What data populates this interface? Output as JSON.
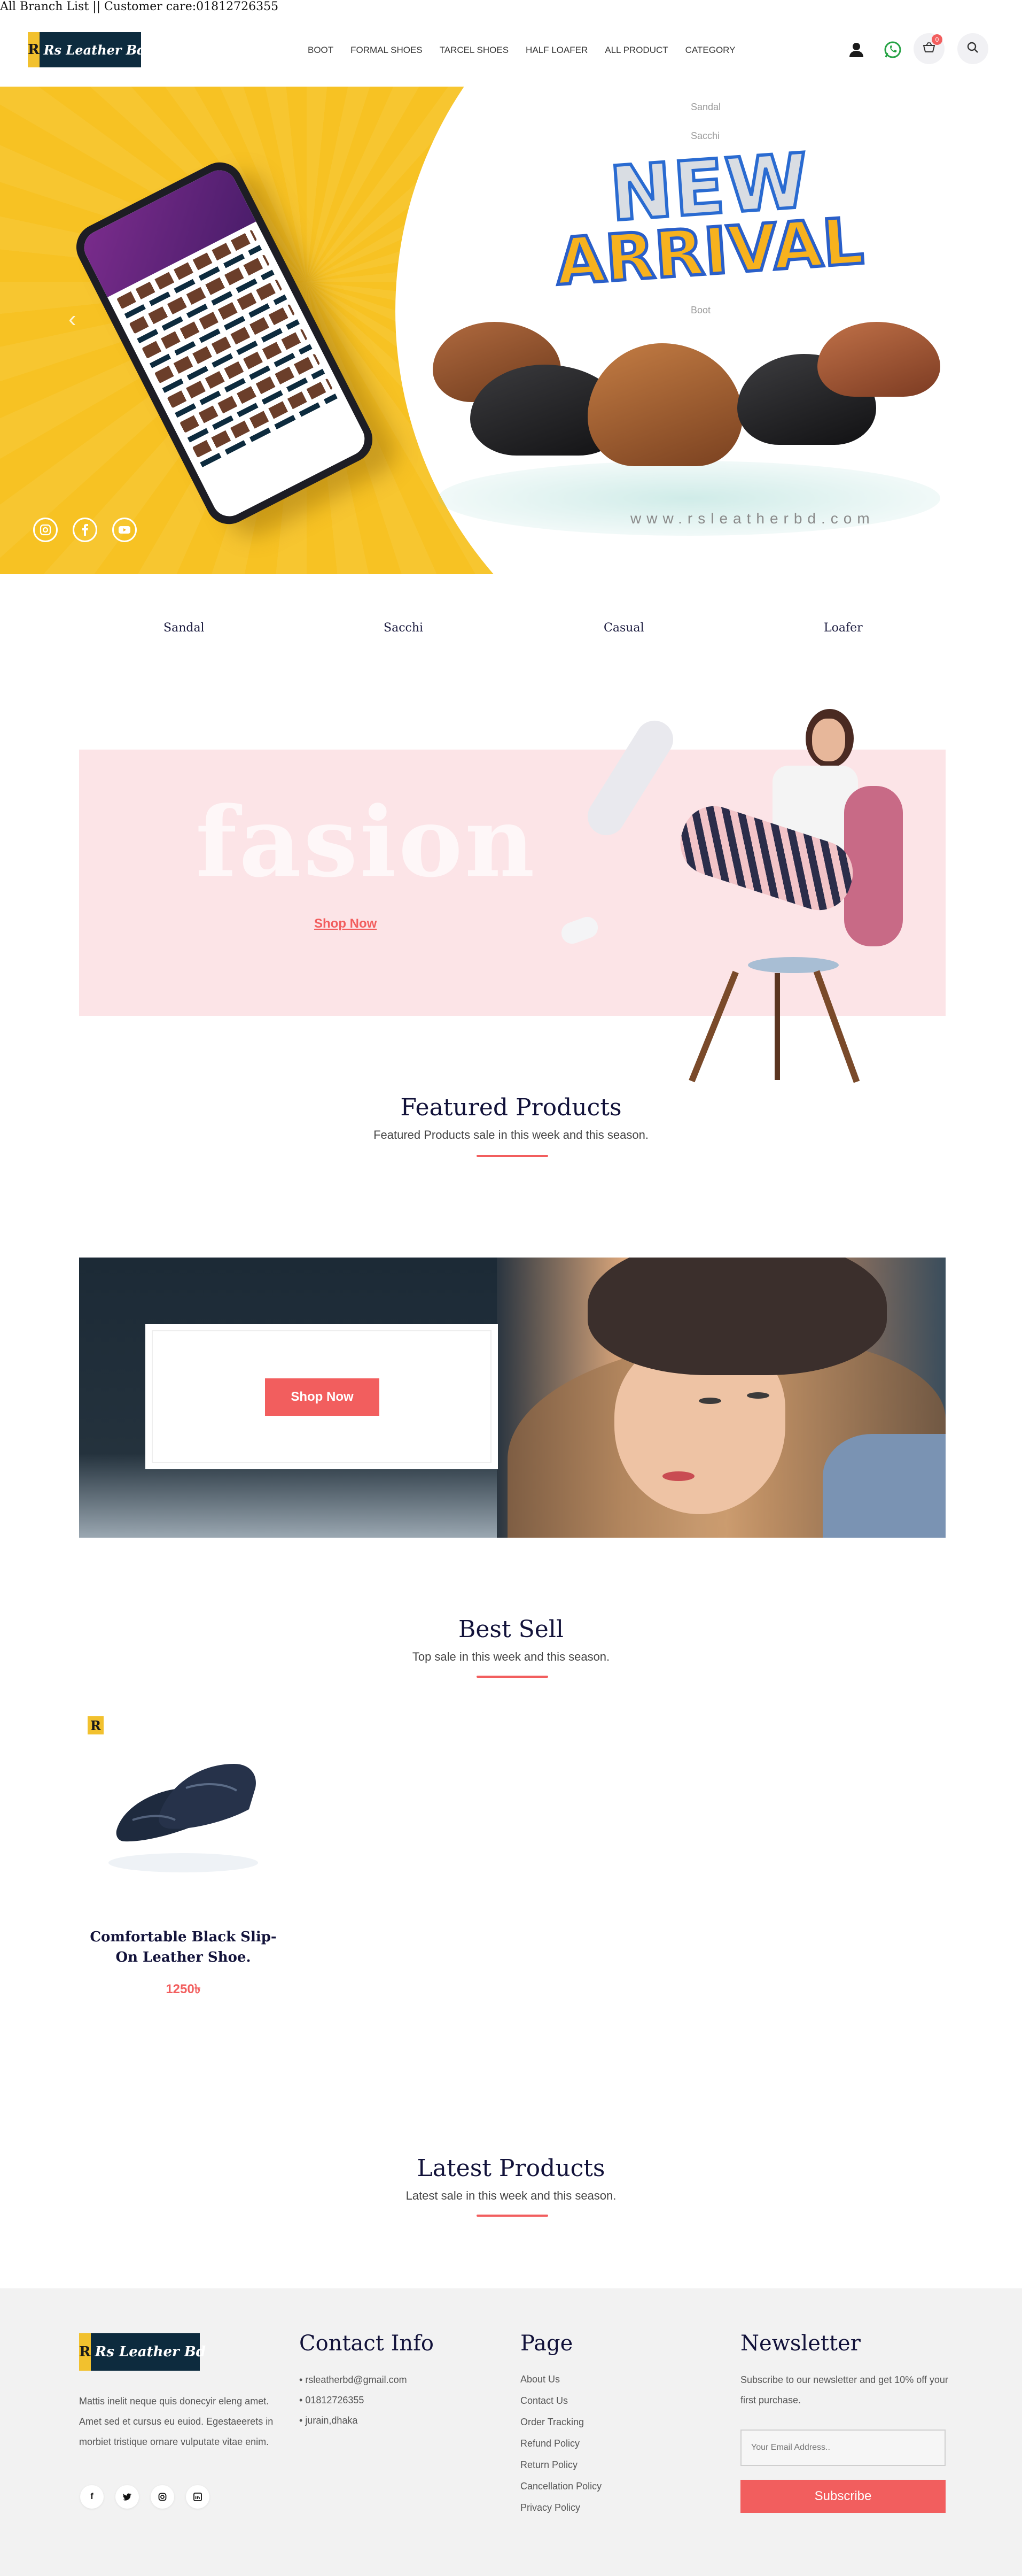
{
  "topbar": {
    "text": "All Branch List || Customer care:01812726355"
  },
  "header": {
    "logo_mark": "R",
    "logo_text": "Rs Leather Bd",
    "nav": [
      "BOOT",
      "FORMAL SHOES",
      "TARCEL SHOES",
      "HALF LOAFER",
      "ALL PRODUCT",
      "CATEGORY"
    ],
    "cart_count": "0",
    "icons": [
      "user-icon",
      "whatsapp-icon",
      "cart-icon",
      "search-icon"
    ]
  },
  "category_dropdown": [
    "Sandal",
    "Sacchi",
    "Boot"
  ],
  "hero": {
    "title_line1": "NEW",
    "title_line2": "ARRIVAL",
    "url": "www.rsleatherbd.com",
    "prev_arrow": "‹",
    "social": [
      "instagram-icon",
      "facebook-icon",
      "youtube-icon"
    ],
    "colors": {
      "yellow": "#f7c223"
    }
  },
  "categories": [
    "Sandal",
    "Sacchi",
    "Casual",
    "Loafer"
  ],
  "fashion_banner": {
    "bg_word": "fasion",
    "cta": "Shop Now"
  },
  "featured": {
    "title": "Featured Products",
    "subtitle": "Featured Products sale in this week and this season."
  },
  "promo_banner": {
    "cta": "Shop Now"
  },
  "best_sell": {
    "title": "Best Sell",
    "subtitle": "Top sale in this week and this season.",
    "products": [
      {
        "name": "Comfortable Black Slip-On Leather Shoe.",
        "price": "1250৳"
      }
    ]
  },
  "latest": {
    "title": "Latest Products",
    "subtitle": "Latest sale in this week and this season."
  },
  "footer": {
    "logo_mark": "R",
    "logo_text": "Rs Leather Bd",
    "about": "Mattis inelit neque quis donecyir eleng amet. Amet sed et cursus eu euiod. Egestaeerets in morbiet tristique ornare vulputate vitae enim.",
    "social": [
      "facebook-icon",
      "twitter-icon",
      "instagram-icon",
      "linkedin-icon"
    ],
    "contact": {
      "title": "Contact Info",
      "items": [
        "rsleatherbd@gmail.com",
        "01812726355",
        "jurain,dhaka"
      ]
    },
    "page": {
      "title": "Page",
      "links": [
        "About Us",
        "Contact Us",
        "Order Tracking",
        "Refund Policy",
        "Return Policy",
        "Cancellation Policy",
        "Privacy Policy"
      ]
    },
    "newsletter": {
      "title": "Newsletter",
      "text": "Subscribe to our newsletter and get 10% off your first purchase.",
      "placeholder": "Your Email Address..",
      "button": "Subscribe"
    }
  }
}
